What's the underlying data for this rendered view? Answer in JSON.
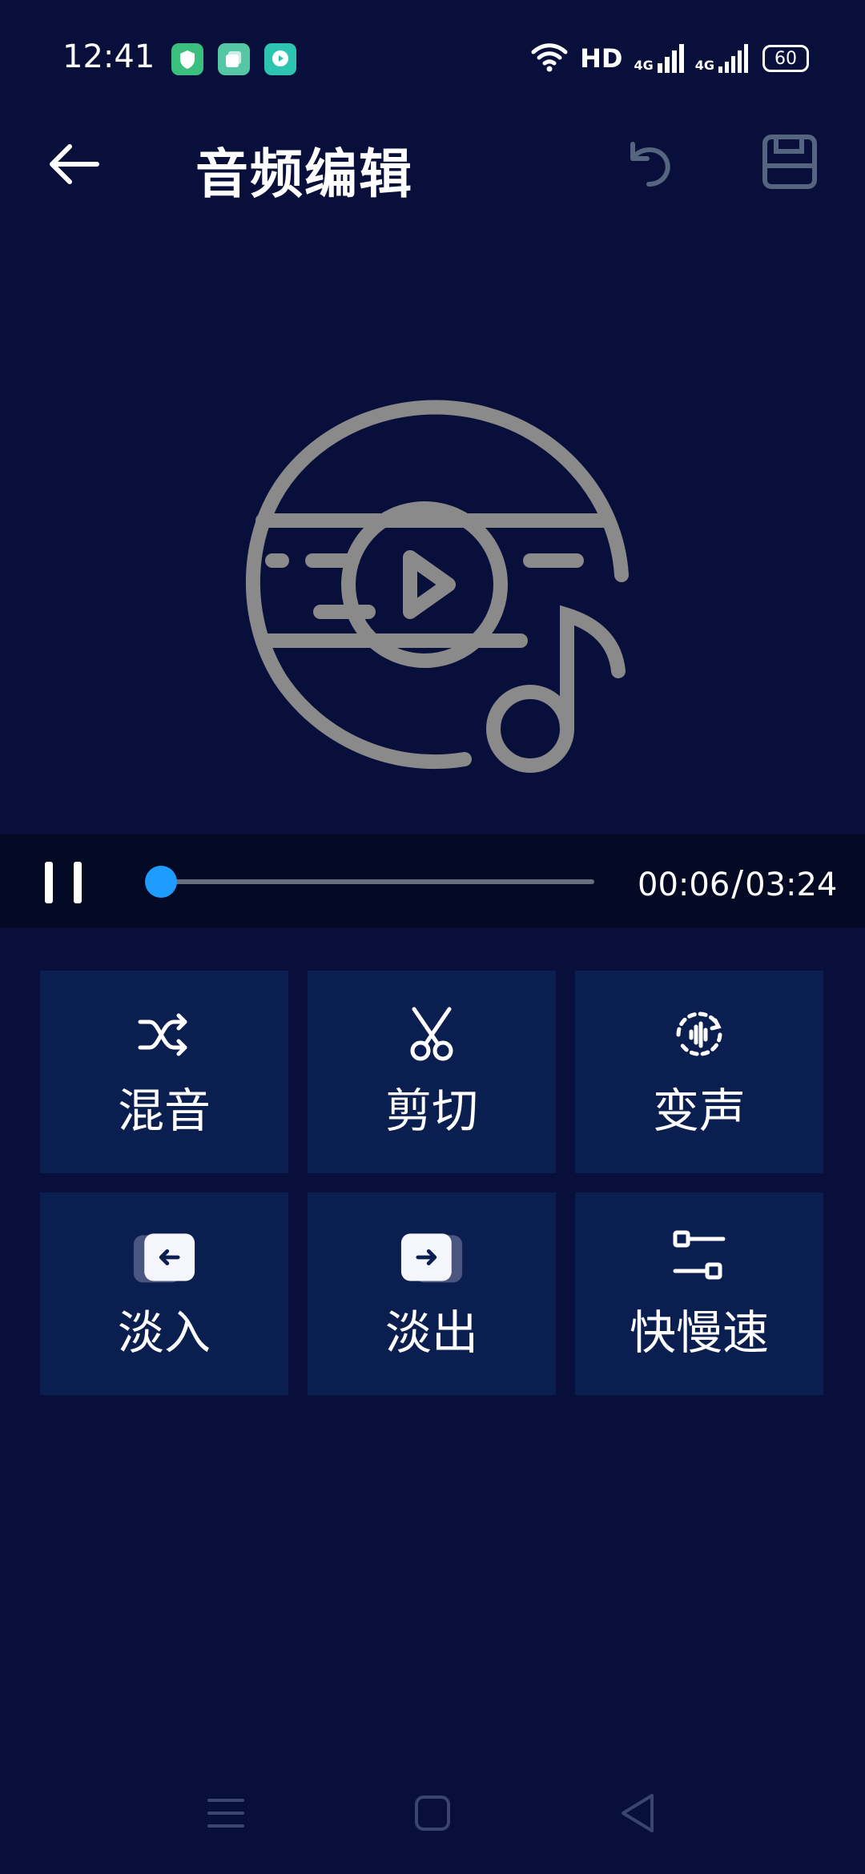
{
  "status_bar": {
    "time": "12:41",
    "network_label": "HD",
    "cell_labels": [
      "4G",
      "4G"
    ],
    "battery": "60"
  },
  "header": {
    "title": "音频编辑",
    "icons": [
      "back-arrow-icon",
      "undo-icon",
      "save-icon"
    ]
  },
  "artwork": {
    "icon": "music-disc-play-icon",
    "color": "#8a8a8a"
  },
  "player": {
    "state": "playing",
    "current_time": "00:06",
    "separator": "/",
    "total_time": "03:24",
    "progress": 0.03,
    "accent_color": "#1e9bff"
  },
  "tools": [
    {
      "id": "mix",
      "label": "混音",
      "icon": "shuffle-icon"
    },
    {
      "id": "cut",
      "label": "剪切",
      "icon": "scissors-icon"
    },
    {
      "id": "voice",
      "label": "变声",
      "icon": "voice-change-icon"
    },
    {
      "id": "fade-in",
      "label": "淡入",
      "icon": "fade-in-icon"
    },
    {
      "id": "fade-out",
      "label": "淡出",
      "icon": "fade-out-icon"
    },
    {
      "id": "speed",
      "label": "快慢速",
      "icon": "speed-sliders-icon"
    }
  ],
  "theme": {
    "background": "#070f3a",
    "card": "#0b1e50",
    "player_bar": "#050a24"
  }
}
